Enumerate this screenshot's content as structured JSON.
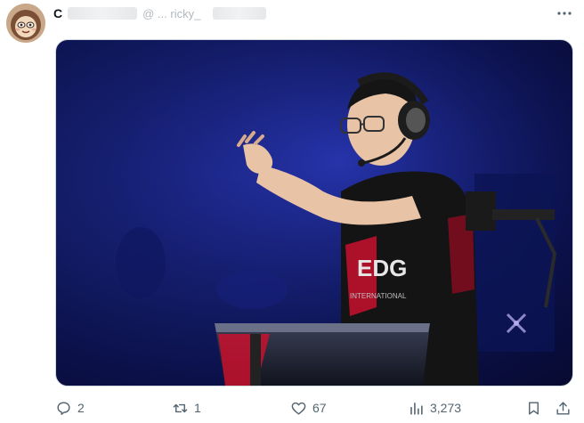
{
  "tweet": {
    "author": {
      "name_visible_start": "C",
      "handle_visible_tail": "@ ... ricky_"
    },
    "media": {
      "alt": "",
      "jersey_text_primary": "EDG",
      "jersey_text_secondary": "INTERNATIONAL"
    },
    "actions": {
      "replies": "2",
      "reposts": "1",
      "likes": "67",
      "views": "3,273"
    }
  },
  "colors": {
    "icon_gray": "#536471",
    "stage_blue": "#141e6a",
    "jersey_red": "#c8102e"
  },
  "icons": [
    "more-icon",
    "reply-icon",
    "repost-icon",
    "like-icon",
    "views-icon",
    "bookmark-icon",
    "share-icon"
  ]
}
